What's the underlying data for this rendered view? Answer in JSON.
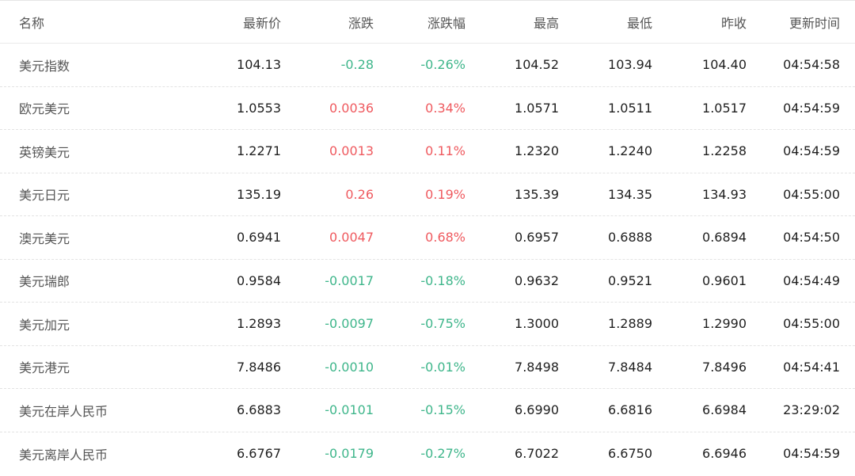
{
  "colors": {
    "up": "#ef5a5f",
    "down": "#3fb68b"
  },
  "headers": {
    "name": "名称",
    "last": "最新价",
    "change": "涨跌",
    "change_pct": "涨跌幅",
    "high": "最高",
    "low": "最低",
    "prev_close": "昨收",
    "update_time": "更新时间"
  },
  "rows": [
    {
      "name": "美元指数",
      "last": "104.13",
      "change": "-0.28",
      "change_pct": "-0.26%",
      "high": "104.52",
      "low": "103.94",
      "prev_close": "104.40",
      "update_time": "04:54:58",
      "direction": "down"
    },
    {
      "name": "欧元美元",
      "last": "1.0553",
      "change": "0.0036",
      "change_pct": "0.34%",
      "high": "1.0571",
      "low": "1.0511",
      "prev_close": "1.0517",
      "update_time": "04:54:59",
      "direction": "up"
    },
    {
      "name": "英镑美元",
      "last": "1.2271",
      "change": "0.0013",
      "change_pct": "0.11%",
      "high": "1.2320",
      "low": "1.2240",
      "prev_close": "1.2258",
      "update_time": "04:54:59",
      "direction": "up"
    },
    {
      "name": "美元日元",
      "last": "135.19",
      "change": "0.26",
      "change_pct": "0.19%",
      "high": "135.39",
      "low": "134.35",
      "prev_close": "134.93",
      "update_time": "04:55:00",
      "direction": "up"
    },
    {
      "name": "澳元美元",
      "last": "0.6941",
      "change": "0.0047",
      "change_pct": "0.68%",
      "high": "0.6957",
      "low": "0.6888",
      "prev_close": "0.6894",
      "update_time": "04:54:50",
      "direction": "up"
    },
    {
      "name": "美元瑞郎",
      "last": "0.9584",
      "change": "-0.0017",
      "change_pct": "-0.18%",
      "high": "0.9632",
      "low": "0.9521",
      "prev_close": "0.9601",
      "update_time": "04:54:49",
      "direction": "down"
    },
    {
      "name": "美元加元",
      "last": "1.2893",
      "change": "-0.0097",
      "change_pct": "-0.75%",
      "high": "1.3000",
      "low": "1.2889",
      "prev_close": "1.2990",
      "update_time": "04:55:00",
      "direction": "down"
    },
    {
      "name": "美元港元",
      "last": "7.8486",
      "change": "-0.0010",
      "change_pct": "-0.01%",
      "high": "7.8498",
      "low": "7.8484",
      "prev_close": "7.8496",
      "update_time": "04:54:41",
      "direction": "down"
    },
    {
      "name": "美元在岸人民币",
      "last": "6.6883",
      "change": "-0.0101",
      "change_pct": "-0.15%",
      "high": "6.6990",
      "low": "6.6816",
      "prev_close": "6.6984",
      "update_time": "23:29:02",
      "direction": "down"
    },
    {
      "name": "美元离岸人民币",
      "last": "6.6767",
      "change": "-0.0179",
      "change_pct": "-0.27%",
      "high": "6.7022",
      "low": "6.6750",
      "prev_close": "6.6946",
      "update_time": "04:54:59",
      "direction": "down"
    }
  ]
}
